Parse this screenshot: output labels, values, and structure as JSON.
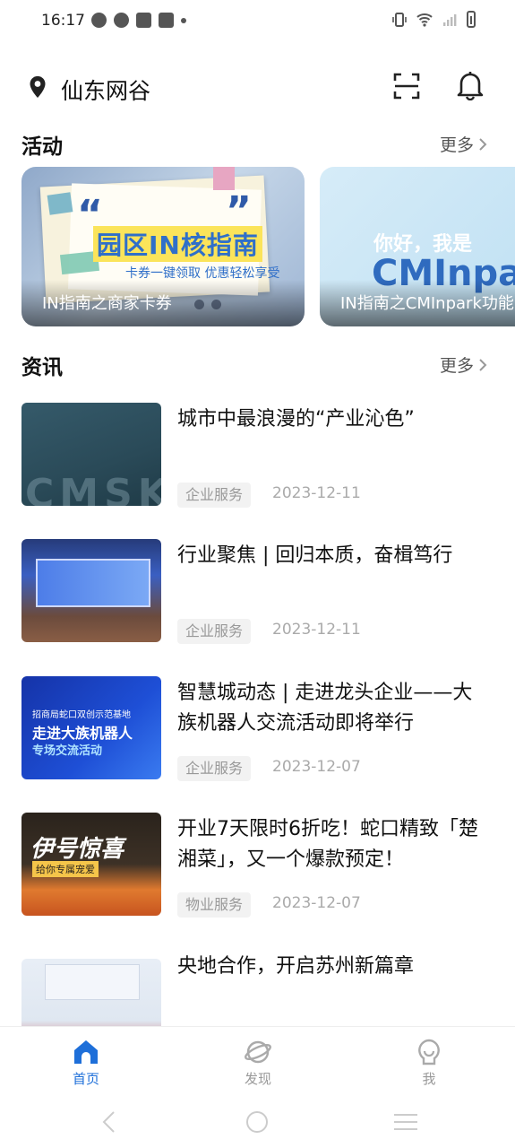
{
  "status_bar": {
    "time": "16:17"
  },
  "header": {
    "location": "仙东网谷"
  },
  "activity": {
    "title": "活动",
    "more": "更多",
    "cards": [
      {
        "caption": "IN指南之商家卡券",
        "headline": "园区IN核指南",
        "subtext": "卡券一键领取 优惠轻松享受"
      },
      {
        "caption": "IN指南之CMInpark功能",
        "hello": "你好，我是",
        "brand": "CMInpark"
      }
    ]
  },
  "news": {
    "title": "资讯",
    "more": "更多",
    "items": [
      {
        "title": "城市中最浪漫的“产业沁色”",
        "tag": "企业服务",
        "date": "2023-12-11",
        "thumb_text": "CMSK"
      },
      {
        "title": "行业聚焦 | 回归本质，奋楫笃行",
        "tag": "企业服务",
        "date": "2023-12-11"
      },
      {
        "title": "智慧城动态 | 走进龙头企业——大族机器人交流活动即将举行",
        "tag": "企业服务",
        "date": "2023-12-07",
        "thumb_line1": "招商局蛇口双创示范基地",
        "thumb_line2": "走进大族机器人",
        "thumb_line3": "专场交流活动"
      },
      {
        "title": "开业7天限时6折吃！蛇口精致「楚湘菜」，又一个爆款预定！",
        "tag": "物业服务",
        "date": "2023-12-07",
        "thumb_line1": "伊号惊喜",
        "thumb_line2": "给你专属宠爱"
      },
      {
        "title": "央地合作，开启苏州新篇章"
      }
    ]
  },
  "tabbar": {
    "tabs": [
      {
        "label": "首页",
        "icon": "home-icon",
        "active": true
      },
      {
        "label": "发现",
        "icon": "planet-icon",
        "active": false
      },
      {
        "label": "我",
        "icon": "profile-icon",
        "active": false
      }
    ]
  },
  "colors": {
    "accent": "#1e6fd9"
  }
}
